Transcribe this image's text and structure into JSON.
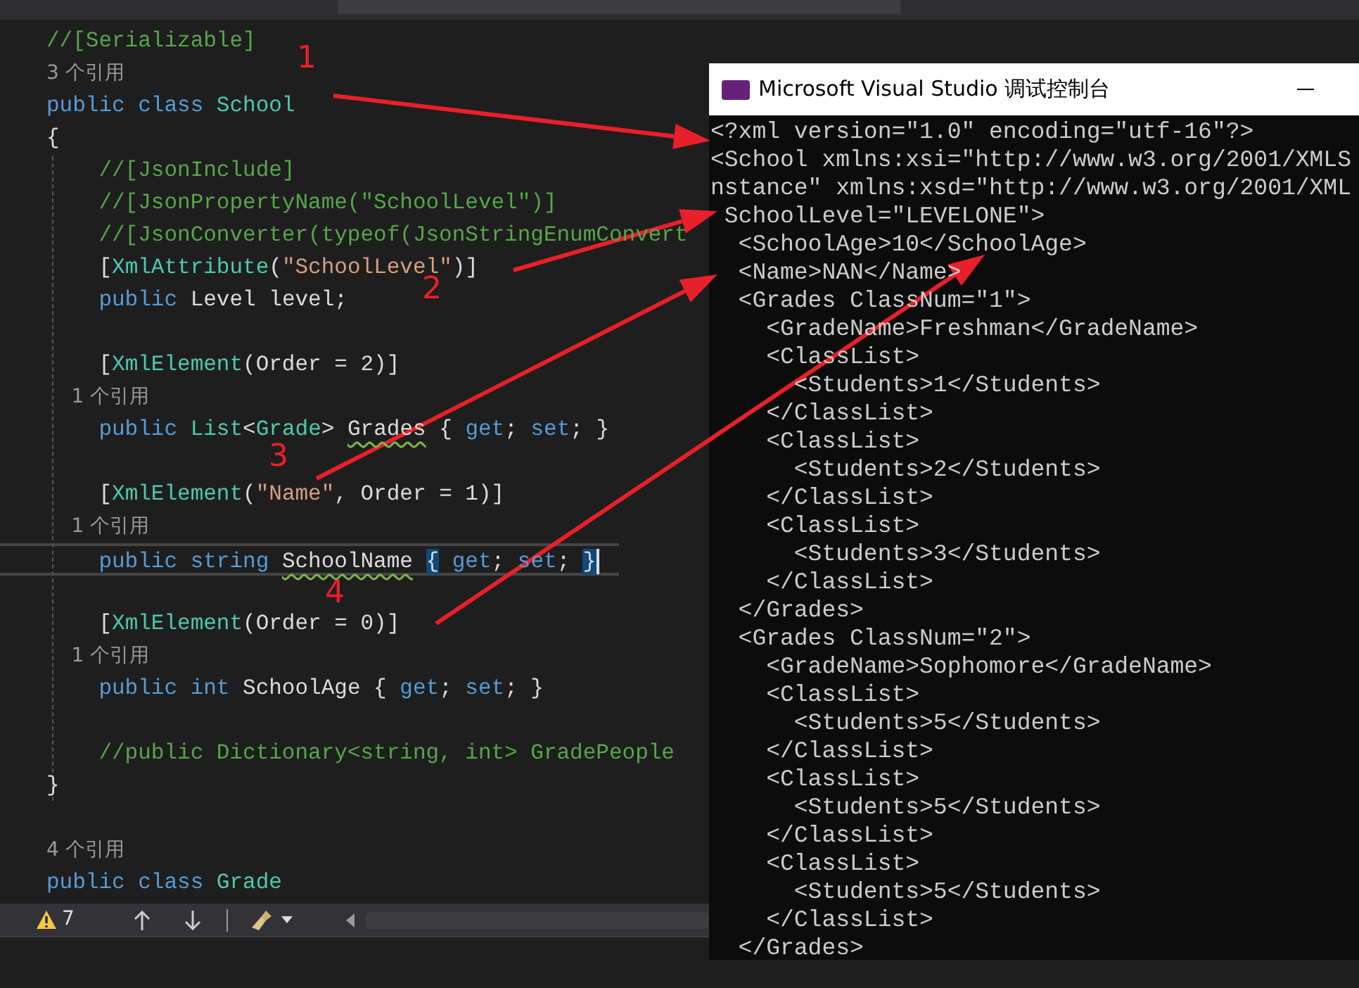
{
  "editor": {
    "lines": [
      {
        "kind": "code",
        "tokens": [
          {
            "t": "//[Serializable]",
            "kind": "cmt"
          }
        ]
      },
      {
        "kind": "lens",
        "tokens": [
          {
            "t": "3 个引用",
            "kind": "lens"
          }
        ]
      },
      {
        "kind": "code",
        "tokens": [
          {
            "t": "public class ",
            "kind": "kw"
          },
          {
            "t": "School",
            "kind": "type"
          }
        ]
      },
      {
        "kind": "code",
        "tokens": [
          {
            "t": "{",
            "kind": "txt"
          }
        ]
      },
      {
        "kind": "code",
        "tokens": [
          {
            "t": "    //[JsonInclude]",
            "kind": "cmt"
          }
        ]
      },
      {
        "kind": "code",
        "tokens": [
          {
            "t": "    //[JsonPropertyName(\"SchoolLevel\")]",
            "kind": "cmt"
          }
        ]
      },
      {
        "kind": "code",
        "tokens": [
          {
            "t": "    //[JsonConverter(typeof(JsonStringEnumConvert",
            "kind": "cmt"
          }
        ]
      },
      {
        "kind": "code",
        "tokens": [
          {
            "t": "    [",
            "kind": "txt"
          },
          {
            "t": "XmlAttribute",
            "kind": "type"
          },
          {
            "t": "(",
            "kind": "txt"
          },
          {
            "t": "\"SchoolLevel\"",
            "kind": "str"
          },
          {
            "t": ")]",
            "kind": "txt"
          }
        ]
      },
      {
        "kind": "code",
        "tokens": [
          {
            "t": "    public ",
            "kind": "kw"
          },
          {
            "t": "Level level;",
            "kind": "txt"
          }
        ]
      },
      {
        "kind": "blank"
      },
      {
        "kind": "code",
        "tokens": [
          {
            "t": "    [",
            "kind": "txt"
          },
          {
            "t": "XmlElement",
            "kind": "type"
          },
          {
            "t": "(Order = 2)]",
            "kind": "txt"
          }
        ]
      },
      {
        "kind": "lens",
        "tokens": [
          {
            "t": "    1 个引用",
            "kind": "lens"
          }
        ]
      },
      {
        "kind": "code",
        "tokens": [
          {
            "t": "    public ",
            "kind": "kw"
          },
          {
            "t": "List",
            "kind": "type"
          },
          {
            "t": "<",
            "kind": "txt"
          },
          {
            "t": "Grade",
            "kind": "type"
          },
          {
            "t": "> ",
            "kind": "txt"
          },
          {
            "t": "Grades",
            "kind": "txt",
            "squiggle": true
          },
          {
            "t": " { ",
            "kind": "txt"
          },
          {
            "t": "get",
            "kind": "kw"
          },
          {
            "t": "; ",
            "kind": "txt"
          },
          {
            "t": "set",
            "kind": "kw"
          },
          {
            "t": "; }",
            "kind": "txt"
          }
        ]
      },
      {
        "kind": "blank"
      },
      {
        "kind": "code",
        "tokens": [
          {
            "t": "    [",
            "kind": "txt"
          },
          {
            "t": "XmlElement",
            "kind": "type"
          },
          {
            "t": "(",
            "kind": "txt"
          },
          {
            "t": "\"Name\"",
            "kind": "str"
          },
          {
            "t": ", Order = 1)]",
            "kind": "txt"
          }
        ]
      },
      {
        "kind": "lens",
        "tokens": [
          {
            "t": "    1 个引用",
            "kind": "lens"
          }
        ]
      },
      {
        "kind": "code",
        "current": true,
        "tokens": [
          {
            "t": "    public string ",
            "kind": "kw"
          },
          {
            "t": "SchoolName ",
            "kind": "txt",
            "squiggle": true
          },
          {
            "t": "{",
            "kind": "txt",
            "match": true
          },
          {
            "t": " get",
            "kind": "kw"
          },
          {
            "t": "; ",
            "kind": "txt"
          },
          {
            "t": "set",
            "kind": "kw"
          },
          {
            "t": "; ",
            "kind": "txt"
          },
          {
            "t": "}",
            "kind": "txt",
            "match": true
          }
        ]
      },
      {
        "kind": "blank"
      },
      {
        "kind": "code",
        "tokens": [
          {
            "t": "    [",
            "kind": "txt"
          },
          {
            "t": "XmlElement",
            "kind": "type"
          },
          {
            "t": "(Order = 0)]",
            "kind": "txt"
          }
        ]
      },
      {
        "kind": "lens",
        "tokens": [
          {
            "t": "    1 个引用",
            "kind": "lens"
          }
        ]
      },
      {
        "kind": "code",
        "tokens": [
          {
            "t": "    public int ",
            "kind": "kw"
          },
          {
            "t": "SchoolAge { ",
            "kind": "txt"
          },
          {
            "t": "get",
            "kind": "kw"
          },
          {
            "t": "; ",
            "kind": "txt"
          },
          {
            "t": "set",
            "kind": "kw"
          },
          {
            "t": "; }",
            "kind": "txt"
          }
        ]
      },
      {
        "kind": "blank"
      },
      {
        "kind": "code",
        "tokens": [
          {
            "t": "    //public Dictionary<string, int> GradePeople",
            "kind": "cmt"
          }
        ]
      },
      {
        "kind": "code",
        "tokens": [
          {
            "t": "}",
            "kind": "txt"
          }
        ]
      },
      {
        "kind": "blank"
      },
      {
        "kind": "lens",
        "tokens": [
          {
            "t": "4 个引用",
            "kind": "lens"
          }
        ]
      },
      {
        "kind": "code",
        "tokens": [
          {
            "t": "public class ",
            "kind": "kw"
          },
          {
            "t": "Grade",
            "kind": "type"
          }
        ]
      }
    ]
  },
  "status_bar": {
    "warnings": "7"
  },
  "console": {
    "title": "Microsoft Visual Studio 调试控制台",
    "lines": [
      "<?xml version=\"1.0\" encoding=\"utf-16\"?>",
      "<School xmlns:xsi=\"http://www.w3.org/2001/XMLS",
      "nstance\" xmlns:xsd=\"http://www.w3.org/2001/XML",
      " SchoolLevel=\"LEVELONE\">",
      "  <SchoolAge>10</SchoolAge>",
      "  <Name>NAN</Name>",
      "  <Grades ClassNum=\"1\">",
      "    <GradeName>Freshman</GradeName>",
      "    <ClassList>",
      "      <Students>1</Students>",
      "    </ClassList>",
      "    <ClassList>",
      "      <Students>2</Students>",
      "    </ClassList>",
      "    <ClassList>",
      "      <Students>3</Students>",
      "    </ClassList>",
      "  </Grades>",
      "  <Grades ClassNum=\"2\">",
      "    <GradeName>Sophomore</GradeName>",
      "    <ClassList>",
      "      <Students>5</Students>",
      "    </ClassList>",
      "    <ClassList>",
      "      <Students>5</Students>",
      "    </ClassList>",
      "    <ClassList>",
      "      <Students>5</Students>",
      "    </ClassList>",
      "  </Grades>"
    ]
  },
  "annotations": [
    {
      "label": "1"
    },
    {
      "label": "2"
    },
    {
      "label": "3"
    },
    {
      "label": "4"
    }
  ]
}
